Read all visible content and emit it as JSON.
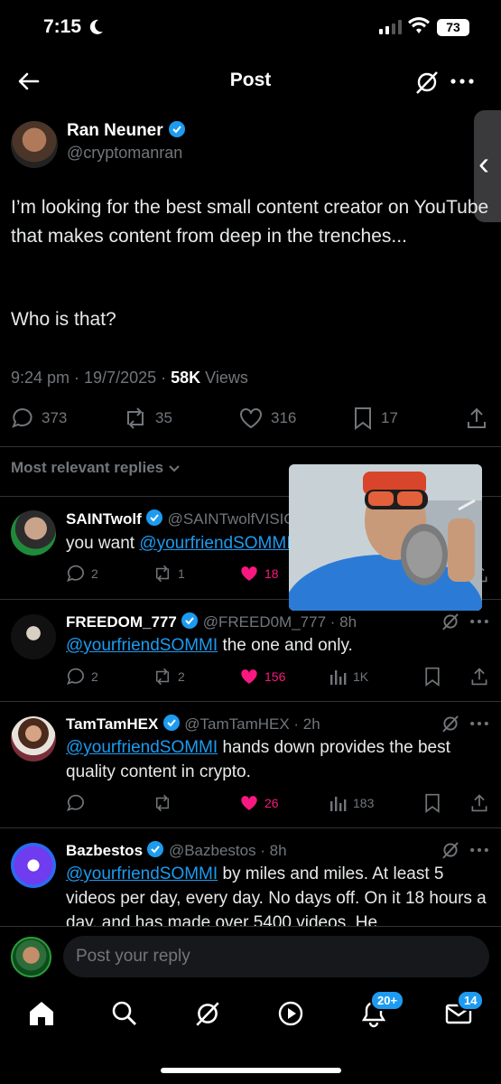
{
  "status_bar": {
    "time": "7:15",
    "battery": "73"
  },
  "header": {
    "title": "Post"
  },
  "post": {
    "author_name": "Ran Neuner",
    "author_handle": "@cryptomanran",
    "text": "I’m looking for the best small content creator on YouTube that makes content from deep in the trenches...",
    "text2": "Who is that?",
    "timestamp": "9:24 pm · 19/7/2025 · ",
    "views_count": "58K",
    "views_label": " Views",
    "stats": {
      "replies": "373",
      "reposts": "35",
      "likes": "316",
      "bookmarks": "17"
    }
  },
  "replies_sort": {
    "label": "Most relevant replies"
  },
  "replies": [
    {
      "name": "SAINTwolf",
      "handle": "@SAINTwolfVISION · 32",
      "text_prefix": "you want  ",
      "mention": "@yourfriendSOMMI",
      "text_suffix": "",
      "replies": "2",
      "reposts": "1",
      "likes": "18",
      "views": ""
    },
    {
      "name": "FREEDOM_777",
      "handle": "@FREED0M_777 · 8h",
      "mention": "@yourfriendSOMMI",
      "text_suffix": " the one and only.",
      "replies": "2",
      "reposts": "2",
      "likes": "156",
      "views": "1K"
    },
    {
      "name": "TamTamHEX",
      "handle": "@TamTamHEX · 2h",
      "mention": "@yourfriendSOMMI",
      "text_suffix": " hands down provides the best quality content in crypto.",
      "replies": "",
      "reposts": "",
      "likes": "26",
      "views": "183"
    },
    {
      "name": "Bazbestos",
      "handle": "@Bazbestos · 8h",
      "mention": "@yourfriendSOMMI",
      "text_suffix": " by miles and miles. At least 5 videos per day, every day. No days off. On it 18 hours a day, and has made over 5400 videos. He"
    }
  ],
  "composer": {
    "placeholder": "Post your reply"
  },
  "nav": {
    "notifications_badge": "20+",
    "messages_badge": "14"
  },
  "colors": {
    "accent": "#1d9bf0",
    "like": "#f91880",
    "muted": "#71767b",
    "background": "#000000"
  }
}
